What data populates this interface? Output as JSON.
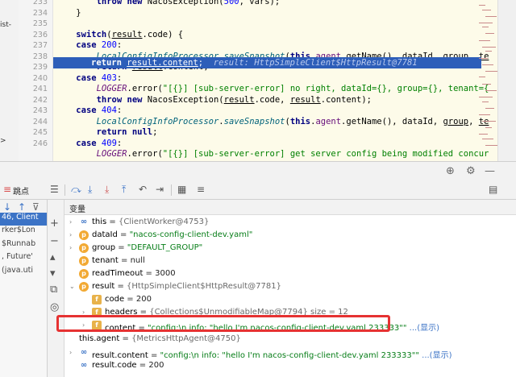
{
  "left_strip": {
    "items": [
      "ist-",
      ">"
    ]
  },
  "editor": {
    "lines": [
      {
        "no": "233",
        "html": "        <span class=\"kw\">throw new</span> NacosException(<span class=\"num\">500</span>, vars);"
      },
      {
        "no": "234",
        "html": "    }"
      },
      {
        "no": "235",
        "html": ""
      },
      {
        "no": "236",
        "html": "    <span class=\"kw\">switch</span>(<span class=\"ul\">result</span>.code) {"
      },
      {
        "no": "237",
        "html": "    <span class=\"kw\">case</span> <span class=\"num\">200</span>:"
      },
      {
        "no": "238",
        "html": ""
      },
      {
        "no": "239",
        "html": "        <span class=\"kw\">return</span> <span class=\"ul\">result</span>.content;"
      },
      {
        "no": "240",
        "html": "    <span class=\"kw\">case</span> <span class=\"num\">403</span>:"
      },
      {
        "no": "241",
        "html": "        <span class=\"sf\">LOGGER</span>.error(<span class=\"str\">\"[{}] [sub-server-error] no right, dataId={}, group={}, tenant={</span>"
      },
      {
        "no": "242",
        "html": "        <span class=\"kw\">throw new</span> NacosException(<span class=\"ul\">result</span>.code, <span class=\"ul\">result</span>.content);"
      },
      {
        "no": "243",
        "html": "    <span class=\"kw\">case</span> <span class=\"num\">404</span>:"
      },
      {
        "no": "244",
        "html": "        <span class=\"sm\">LocalConfigInfoProcessor</span>.<span class=\"sm\">saveSnapshot</span>(<span class=\"kw\">this</span>.<span class=\"fld\">agent</span>.getName(), dataId, <span class=\"ul\">group</span>, <span class=\"ul\">te</span>"
      },
      {
        "no": "245",
        "html": "        <span class=\"kw\">return null</span>;"
      },
      {
        "no": "246",
        "html": "    <span class=\"kw\">case</span> <span class=\"num\">409</span>:"
      },
      {
        "no": "",
        "html": "        <span class=\"sf\">LOGGER</span>.error(<span class=\"str\">\"[{}] [sub-server-error] get server config being modified concur</span>"
      }
    ],
    "line_238": "        <span class=\"sm\">LocalConfigInfoProcessor</span>.<span class=\"sm\">saveSnapshot</span>(<span class=\"kw\">this</span>.<span class=\"fld\">agent</span>.getName(), dataId, <span class=\"ul\">group</span>, <span class=\"ul\">te</span>",
    "current_line_html": "<span class=\"kw\">return</span> <span class=\"ul\">result.content</span>;  <span class=\"hint\">result: HttpSimpleClient$HttpResult@7781</span>"
  },
  "toolbar": {
    "breakpoints_label": "跳点"
  },
  "frames": {
    "items": [
      {
        "text": "46, Client",
        "selected": true
      },
      {
        "text": "rker$Lon",
        "selected": false
      },
      {
        "text": "$Runnab",
        "selected": false
      },
      {
        "text": ", Future'",
        "selected": false
      },
      {
        "text": "(java.uti",
        "selected": false
      },
      {
        "text": "",
        "selected": false
      },
      {
        "text": "Task (jav",
        "selected": false
      },
      {
        "text": "duledThre",
        "selected": false
      },
      {
        "text": "eduledThr",
        "selected": false
      },
      {
        "text": "eduledThr",
        "selected": false
      }
    ]
  },
  "variables": {
    "title": "变量",
    "rows": [
      {
        "indent": 0,
        "arrow": "›",
        "icon": "oo",
        "name": "this",
        "eq": " = ",
        "value": "{ClientWorker@4753}",
        "vclass": "vgray"
      },
      {
        "indent": 0,
        "arrow": "›",
        "icon": "p",
        "name": "dataId",
        "eq": " = ",
        "value": "\"nacos-config-client-dev.yaml\"",
        "vclass": "vstr"
      },
      {
        "indent": 0,
        "arrow": "›",
        "icon": "p",
        "name": "group",
        "eq": " = ",
        "value": "\"DEFAULT_GROUP\"",
        "vclass": "vstr"
      },
      {
        "indent": 0,
        "arrow": "",
        "icon": "p",
        "name": "tenant",
        "eq": " = ",
        "value": "null",
        "vclass": ""
      },
      {
        "indent": 0,
        "arrow": "",
        "icon": "p",
        "name": "readTimeout",
        "eq": " = ",
        "value": "3000",
        "vclass": ""
      },
      {
        "indent": 0,
        "arrow": "⌄",
        "icon": "p",
        "name": "result",
        "eq": " = ",
        "value": "{HttpSimpleClient$HttpResult@7781}",
        "vclass": "vgray"
      },
      {
        "indent": 1,
        "arrow": "",
        "icon": "f",
        "name": "code",
        "eq": " = ",
        "value": "200",
        "vclass": ""
      },
      {
        "indent": 1,
        "arrow": "›",
        "icon": "f",
        "name": "headers",
        "eq": " = ",
        "value": "{Collections$UnmodifiableMap@7794}  size = 12",
        "vclass": "vgray"
      },
      {
        "indent": 1,
        "arrow": "›",
        "icon": "f",
        "name": "content",
        "eq": " = ",
        "value": "\"config:\\n   info: \"hello I'm nacos-config-client-dev.yaml 233333\"\" ...(显示)",
        "vclass": "vstr"
      },
      {
        "indent": 0,
        "arrow": "",
        "icon": "",
        "name": "this.agent",
        "eq": " = ",
        "value": "{MetricsHttpAgent@4750}",
        "vclass": "vgray"
      },
      {
        "indent": 0,
        "arrow": "›",
        "icon": "oo",
        "name": "result.content",
        "eq": " = ",
        "value": "\"config:\\n   info: \"hello I'm nacos-config-client-dev.yaml 233333\"\" ...(显示)",
        "vclass": "vstr"
      },
      {
        "indent": 0,
        "arrow": "",
        "icon": "oo",
        "name": "result.code",
        "eq": " = ",
        "value": "200",
        "vclass": ""
      }
    ]
  }
}
